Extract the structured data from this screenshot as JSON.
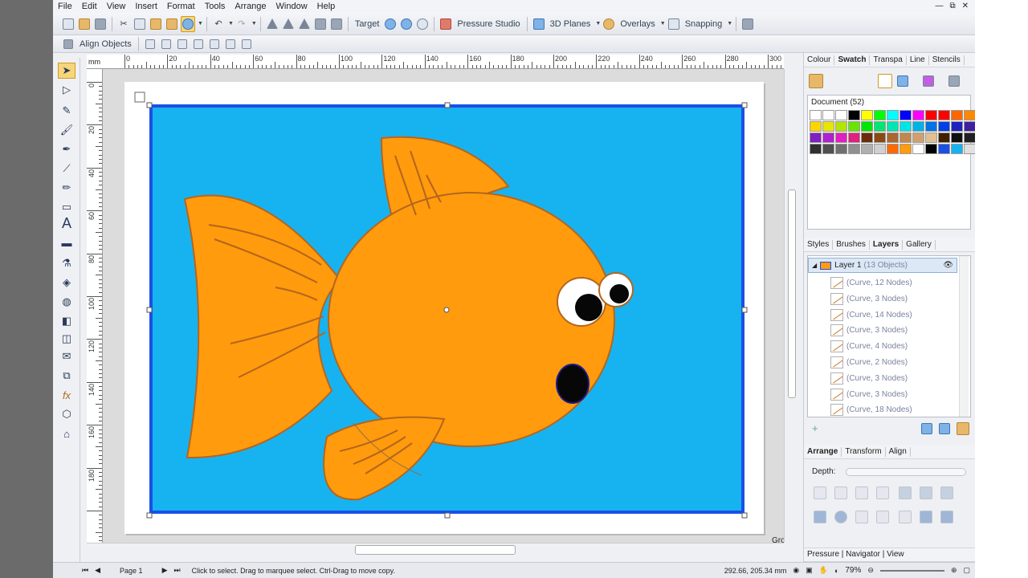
{
  "menu": [
    "File",
    "Edit",
    "View",
    "Insert",
    "Format",
    "Tools",
    "Arrange",
    "Window",
    "Help"
  ],
  "window_controls": [
    "—",
    "⧉",
    "✕"
  ],
  "toolbar": {
    "target_label": "Target",
    "pressure_label": "Pressure Studio",
    "planes_label": "3D Planes",
    "overlays_label": "Overlays",
    "snapping_label": "Snapping"
  },
  "align_bar": {
    "label": "Align Objects"
  },
  "ruler": {
    "unit": "mm",
    "h_labels": [
      "0",
      "20",
      "40",
      "60",
      "80",
      "100",
      "120",
      "140",
      "160",
      "180",
      "200",
      "220",
      "240",
      "260",
      "280",
      "300"
    ],
    "v_labels": [
      "0",
      "20",
      "40",
      "60",
      "80",
      "100",
      "120",
      "140",
      "160",
      "180"
    ]
  },
  "canvas": {
    "group_label": "Group",
    "background_color": "#17b3f0",
    "fish_color": "#ff9b0c",
    "outline_color": "#b4651d",
    "border_color": "#1a50e6"
  },
  "status": {
    "page": "Page 1",
    "hint": "Click to select. Drag to marquee select. Ctrl-Drag to move copy.",
    "coords": "292.66, 205.34 mm",
    "zoom": "79%"
  },
  "panel_top": {
    "tabs": [
      "Colour",
      "Swatch",
      "Transpa",
      "Line",
      "Stencils"
    ],
    "active_tab": "Swatch",
    "document_label": "Document (52)",
    "swatches": [
      "#ffffff",
      "#ffffff",
      "#ffffff",
      "#000000",
      "#ffff00",
      "#00ff00",
      "#00ffff",
      "#0000ff",
      "#ff00ff",
      "#ff0000",
      "#ff0000",
      "#ff6600",
      "#ff8800",
      "#ffd400",
      "#e6e600",
      "#b3e600",
      "#66e600",
      "#00e600",
      "#00e673",
      "#00e6b3",
      "#00e6e6",
      "#00b3e6",
      "#0073e6",
      "#0040e6",
      "#2020c0",
      "#4020a0",
      "#8020c0",
      "#b020d0",
      "#e020c0",
      "#e02080",
      "#6b2c0a",
      "#8a4a14",
      "#a86830",
      "#c08850",
      "#d0a070",
      "#e0c090",
      "#402000",
      "#101010",
      "#202020",
      "#303030",
      "#505050",
      "#707070",
      "#909090",
      "#b0b0b0",
      "#d0d0d0",
      "#ff6a00",
      "#ff9b0c",
      "#ffffff",
      "#000000",
      "#1a50e6",
      "#17b3f0",
      "#e0e0e0"
    ]
  },
  "panel_mid": {
    "tabs": [
      "Styles",
      "Brushes",
      "Layers",
      "Gallery"
    ],
    "active_tab": "Layers",
    "layer_name": "Layer 1",
    "layer_count": "(13 Objects)",
    "items": [
      "(Curve, 12 Nodes)",
      "(Curve, 3 Nodes)",
      "(Curve, 14 Nodes)",
      "(Curve, 3 Nodes)",
      "(Curve, 4 Nodes)",
      "(Curve, 2 Nodes)",
      "(Curve, 3 Nodes)",
      "(Curve, 3 Nodes)",
      "(Curve, 18 Nodes)"
    ]
  },
  "panel_bottom": {
    "tabs": [
      "Arrange",
      "Transform",
      "Align"
    ],
    "active_tab": "Arrange",
    "depth_label": "Depth:"
  },
  "panel_footer": {
    "label": "Pressure | Navigator | View"
  }
}
